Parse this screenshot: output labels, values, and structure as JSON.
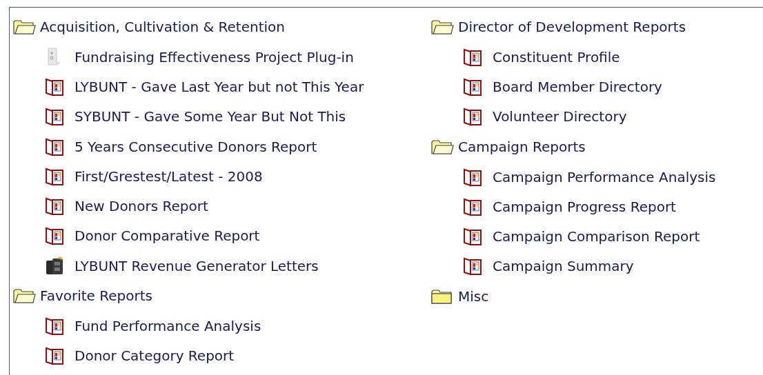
{
  "columns": [
    {
      "folders": [
        {
          "label": "Acquisition, Cultivation & Retention",
          "expanded": true,
          "items": [
            {
              "label": "Fundraising Effectiveness Project Plug-in",
              "kind": "plugin"
            },
            {
              "label": "LYBUNT - Gave Last Year but not This Year",
              "kind": "report"
            },
            {
              "label": "SYBUNT - Gave Some Year But Not This",
              "kind": "report"
            },
            {
              "label": "5 Years Consecutive Donors Report",
              "kind": "report"
            },
            {
              "label": "First/Grestest/Latest - 2008",
              "kind": "report"
            },
            {
              "label": "New Donors Report",
              "kind": "report"
            },
            {
              "label": "Donor Comparative Report",
              "kind": "report"
            },
            {
              "label": "LYBUNT Revenue Generator Letters",
              "kind": "letters"
            }
          ]
        },
        {
          "label": "Favorite Reports",
          "expanded": true,
          "items": [
            {
              "label": "Fund Performance Analysis",
              "kind": "report"
            },
            {
              "label": "Donor Category Report",
              "kind": "report"
            }
          ]
        }
      ]
    },
    {
      "folders": [
        {
          "label": "Director of Development Reports",
          "expanded": true,
          "items": [
            {
              "label": "Constituent Profile",
              "kind": "report"
            },
            {
              "label": "Board Member Directory",
              "kind": "report"
            },
            {
              "label": "Volunteer Directory",
              "kind": "report"
            }
          ]
        },
        {
          "label": "Campaign Reports",
          "expanded": true,
          "items": [
            {
              "label": "Campaign Performance Analysis",
              "kind": "report"
            },
            {
              "label": "Campaign Progress Report",
              "kind": "report"
            },
            {
              "label": "Campaign Comparison Report",
              "kind": "report"
            },
            {
              "label": "Campaign Summary",
              "kind": "report"
            }
          ]
        },
        {
          "label": "Misc",
          "expanded": false
        }
      ]
    }
  ]
}
